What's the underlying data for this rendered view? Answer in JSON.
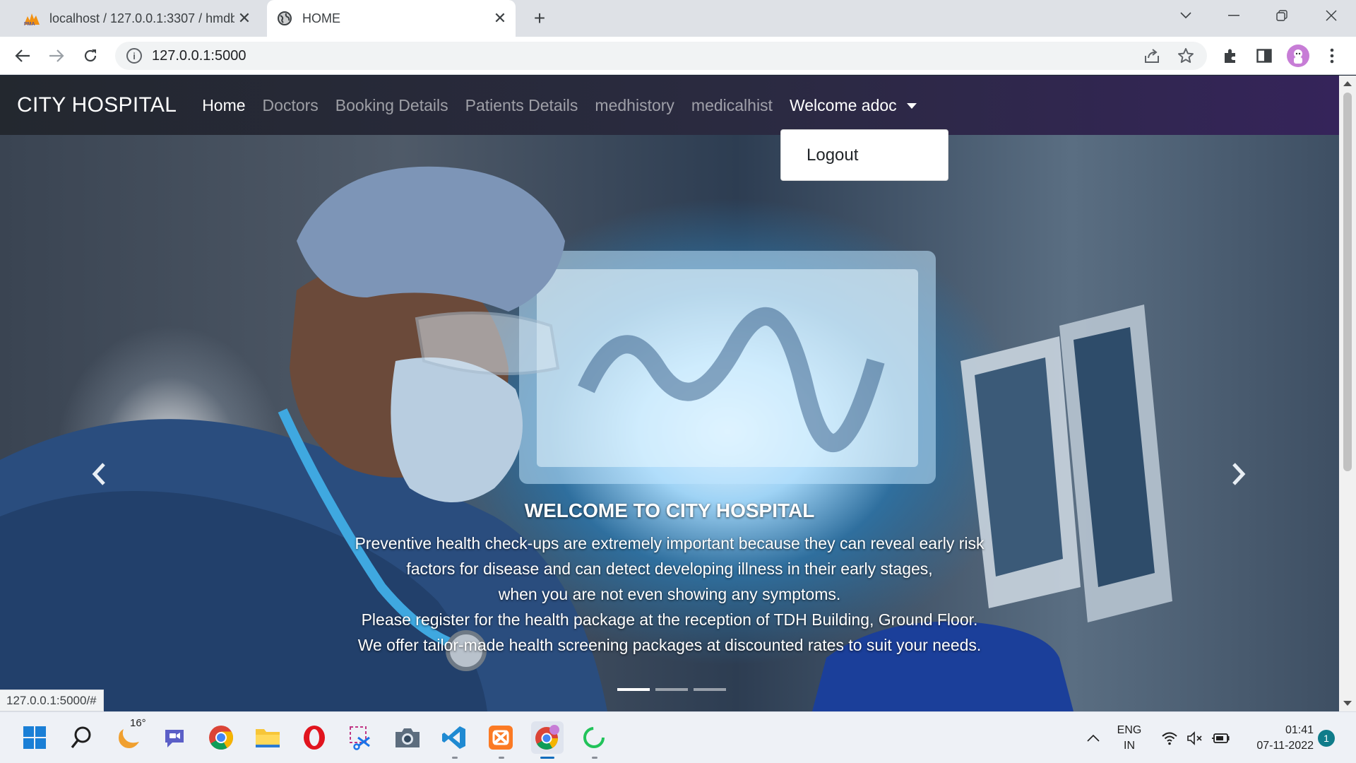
{
  "browser": {
    "tabs": [
      {
        "title": "localhost / 127.0.0.1:3307 / hmdb",
        "favicon": "phpmyadmin-icon",
        "active": false
      },
      {
        "title": "HOME",
        "favicon": "globe-icon",
        "active": true
      }
    ],
    "url": "127.0.0.1:5000",
    "status_url": "127.0.0.1:5000/#"
  },
  "navbar": {
    "brand": "CITY HOSPITAL",
    "links": [
      "Home",
      "Doctors",
      "Booking Details",
      "Patients Details",
      "medhistory",
      "medicalhist"
    ],
    "active_link": "Home",
    "user_menu": "Welcome adoc",
    "dropdown_items": [
      "Logout"
    ]
  },
  "carousel": {
    "caption_title": "WELCOME TO CITY HOSPITAL",
    "caption_lines": [
      "Preventive health check-ups are extremely important because they can reveal early risk",
      "factors for disease and can detect developing illness in their early stages,",
      "when you are not even showing any symptoms.",
      "Please register for the health package at the reception of TDH Building, Ground Floor.",
      "We offer tailor-made health screening packages at discounted rates to suit your needs."
    ],
    "slides": 3,
    "active_slide": 1
  },
  "taskbar": {
    "weather_temp": "16°",
    "language": "ENG",
    "region": "IN",
    "time": "01:41",
    "date": "07-11-2022",
    "notifications": "1"
  },
  "colors": {
    "navbar_start": "#23282f",
    "navbar_end": "#35245a",
    "accent_taskbar": "#0f6cbd"
  }
}
